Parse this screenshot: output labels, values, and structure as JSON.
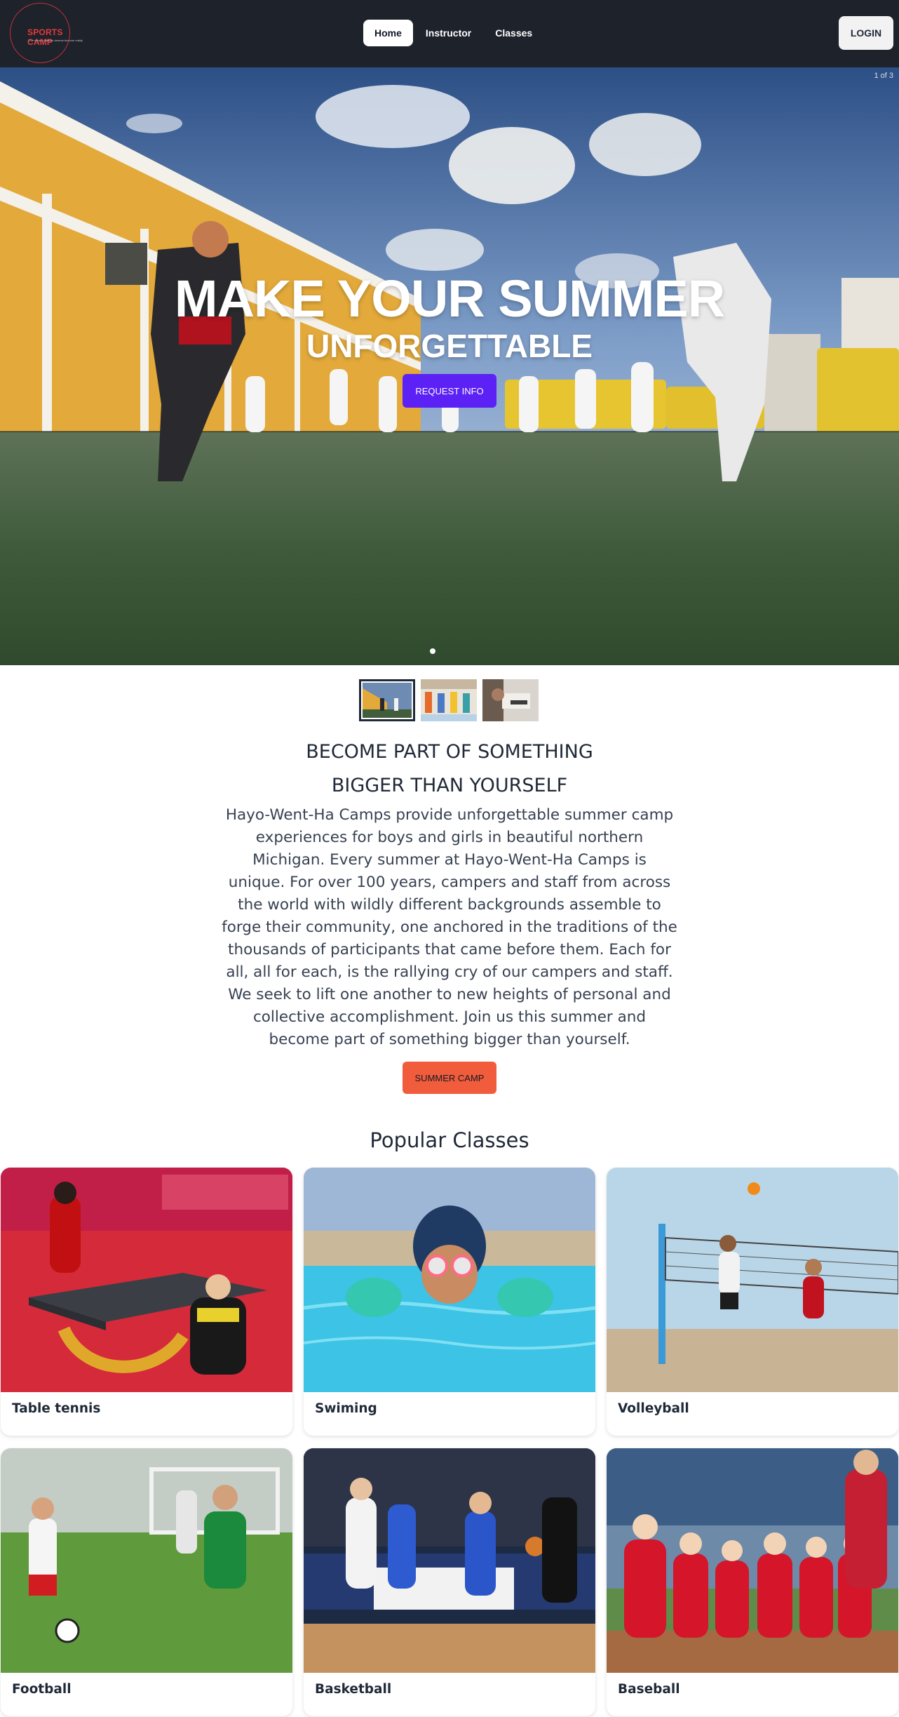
{
  "navbar": {
    "logo_title": "SPORTS CAMP",
    "logo_subtitle": "Fun camp & athletic dreams become reality",
    "links": [
      {
        "label": "Home",
        "active": true
      },
      {
        "label": "Instructor",
        "active": false
      },
      {
        "label": "Classes",
        "active": false
      }
    ],
    "login_label": "LOGIN"
  },
  "hero": {
    "slide_counter": "1 of 3",
    "title": "MAKE YOUR SUMMER",
    "subtitle": "UNFORGETTABLE",
    "button_label": "REQUEST INFO",
    "image_icon": "karate-class-photo",
    "active_slide": 1,
    "total_slides": 3
  },
  "thumbnails": [
    {
      "icon": "karate-thumbnail",
      "active": true
    },
    {
      "icon": "gym-thumbnail",
      "active": false
    },
    {
      "icon": "dumbbell-thumbnail",
      "active": false
    }
  ],
  "about": {
    "heading_line1": "BECOME PART OF SOMETHING",
    "heading_line2": "BIGGER THAN YOURSELF",
    "text_lines": [
      "Hayo-Went-Ha Camps provide unforgettable summer camp",
      "experiences for boys and girls in beautiful northern",
      "Michigan. Every summer at Hayo-Went-Ha Camps is",
      "unique. For over 100 years, campers and staff from across",
      "the world with wildly different backgrounds assemble to",
      "forge their community, one anchored in the traditions of the",
      "thousands of participants that came before them. Each for",
      "all, all for each, is the rallying cry of our campers and staff.",
      "We seek to lift one another to new heights of personal and",
      "collective accomplishment. Join us this summer and",
      "become part of something bigger than yourself."
    ],
    "button_label": "SUMMER CAMP"
  },
  "classes": {
    "heading": "Popular Classes",
    "items": [
      {
        "label": "Table tennis",
        "icon": "table-tennis-photo"
      },
      {
        "label": "Swiming",
        "icon": "swimming-photo"
      },
      {
        "label": "Volleyball",
        "icon": "volleyball-photo"
      },
      {
        "label": "Football",
        "icon": "football-photo"
      },
      {
        "label": "Basketball",
        "icon": "basketball-photo"
      },
      {
        "label": "Baseball",
        "icon": "baseball-photo"
      }
    ]
  },
  "colors": {
    "navbar_bg": "#1e222b",
    "primary_button": "#5b21f5",
    "accent_button": "#f15d3c",
    "logo_red": "#e23b3b",
    "text_dark": "#1f2937"
  }
}
